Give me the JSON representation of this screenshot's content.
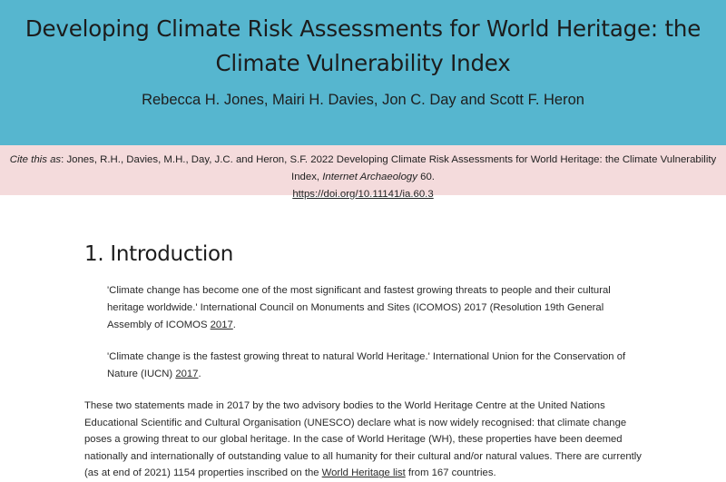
{
  "header": {
    "title": "Developing Climate Risk Assessments for World Heritage: the Climate Vulnerability Index",
    "authors": "Rebecca H. Jones, Mairi H. Davies, Jon C. Day and Scott F. Heron",
    "bg_color": "#56b6cf"
  },
  "citation": {
    "label": "Cite this as",
    "text": ": Jones, R.H., Davies, M.H., Day, J.C. and Heron, S.F. 2022 Developing Climate Risk Assessments for World Heritage: the Climate Vulnerability Index, ",
    "journal": "Internet Archaeology",
    "volume": " 60.",
    "doi": "https://doi.org/10.11141/ia.60.3",
    "bg_color": "#f4dbdc"
  },
  "section": {
    "heading": "1. Introduction",
    "quote1": {
      "text": "'Climate change has become one of the most significant and fastest growing threats to people and their cultural heritage worldwide.' International Council on Monuments and Sites (ICOMOS) 2017 (Resolution 19th General Assembly of ICOMOS ",
      "link": "2017",
      "end": "."
    },
    "quote2": {
      "text": "'Climate change is the fastest growing threat to natural World Heritage.' International Union for the Conservation of Nature (IUCN) ",
      "link": "2017",
      "end": "."
    },
    "paragraph": {
      "text": "These two statements made in 2017 by the two advisory bodies to the World Heritage Centre at the United Nations Educational Scientific and Cultural Organisation (UNESCO) declare what is now widely recognised: that climate change poses a growing threat to our global heritage. In the case of World Heritage (WH), these properties have been deemed nationally and internationally of outstanding value to all humanity for their cultural and/or natural values. There are currently (as at end of 2021) 1154 properties inscribed on the ",
      "link": "World Heritage list",
      "end": " from 167 countries."
    }
  }
}
